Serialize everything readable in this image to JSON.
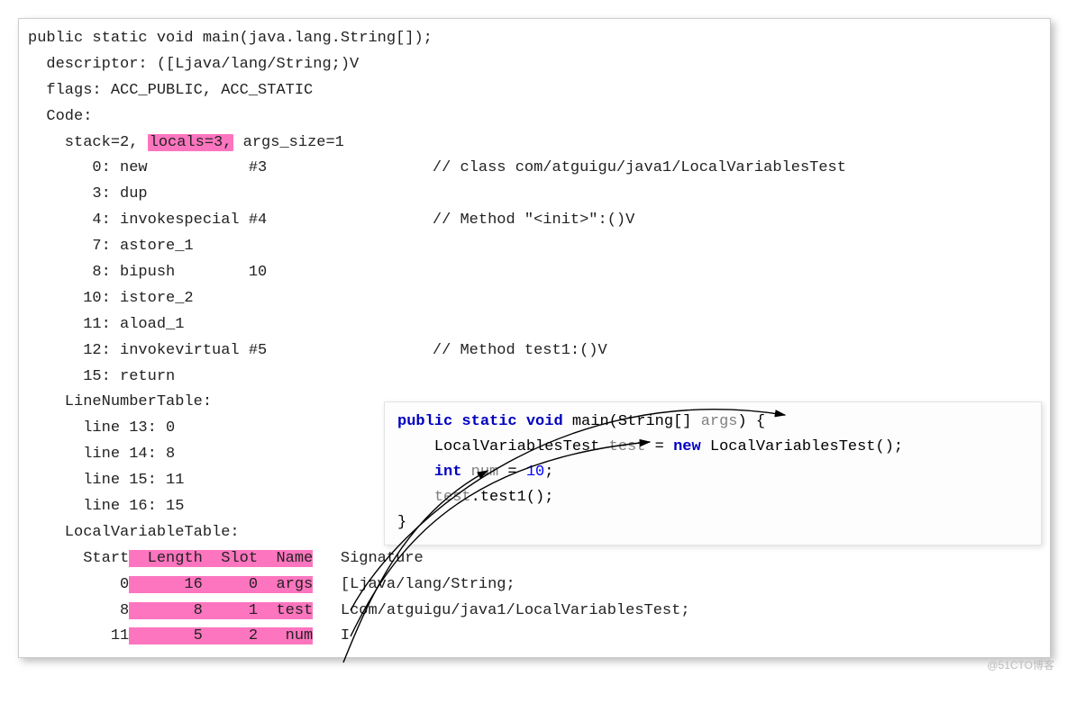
{
  "bytecode": {
    "signature": "public static void main(java.lang.String[]);",
    "descriptor": "  descriptor: ([Ljava/lang/String;)V",
    "flags": "  flags: ACC_PUBLIC, ACC_STATIC",
    "code_label": "  Code:",
    "stack_prefix": "    stack=2, ",
    "locals_hl": "locals=3,",
    "args_suffix": " args_size=1",
    "instructions": [
      "       0: new           #3                  // class com/atguigu/java1/LocalVariablesTest",
      "       3: dup",
      "       4: invokespecial #4                  // Method \"<init>\":()V",
      "       7: astore_1",
      "       8: bipush        10",
      "      10: istore_2",
      "      11: aload_1",
      "      12: invokevirtual #5                  // Method test1:()V",
      "      15: return"
    ],
    "lnt_label": "    LineNumberTable:",
    "lnt": [
      "      line 13: 0",
      "      line 14: 8",
      "      line 15: 11",
      "      line 16: 15"
    ],
    "lvt_label": "    LocalVariableTable:",
    "lvt_header_pre": "      Start",
    "lvt_header_pink": "  Length  Slot  Name",
    "lvt_header_post": "   Signature",
    "lvt_rows": [
      {
        "pre": "          0",
        "pink": "      16     0  args",
        "post": "   [Ljava/lang/String;"
      },
      {
        "pre": "          8",
        "pink": "       8     1  test",
        "post": "   Lcom/atguigu/java1/LocalVariablesTest;"
      },
      {
        "pre": "         11",
        "pink": "       5     2   num",
        "post": "   I"
      }
    ]
  },
  "inset": {
    "sig_public": "public",
    "sig_static": "static",
    "sig_void": "void",
    "sig_main": " main(String[] ",
    "sig_args": "args",
    "sig_close": ") {",
    "l2_a": "    LocalVariablesTest ",
    "l2_test": "test",
    "l2_eq": " = ",
    "l2_new": "new",
    "l2_b": " LocalVariablesTest();",
    "l3_int": "int",
    "l3_num": " num",
    "l3_eq": " = ",
    "l3_10": "10",
    "l3_end": ";",
    "l4_a": "    ",
    "l4_test": "test",
    "l4_b": ".test1();",
    "l5": "}"
  },
  "chart_data": {
    "type": "table",
    "title": "LocalVariableTable",
    "columns": [
      "Start",
      "Length",
      "Slot",
      "Name",
      "Signature"
    ],
    "rows": [
      [
        0,
        16,
        0,
        "args",
        "[Ljava/lang/String;"
      ],
      [
        8,
        8,
        1,
        "test",
        "Lcom/atguigu/java1/LocalVariablesTest;"
      ],
      [
        11,
        5,
        2,
        "num",
        "I"
      ]
    ],
    "line_number_table": [
      [
        13,
        0
      ],
      [
        14,
        8
      ],
      [
        15,
        11
      ],
      [
        16,
        15
      ]
    ],
    "stack": 2,
    "locals": 3,
    "args_size": 1
  },
  "watermark": "@51CTO博客"
}
